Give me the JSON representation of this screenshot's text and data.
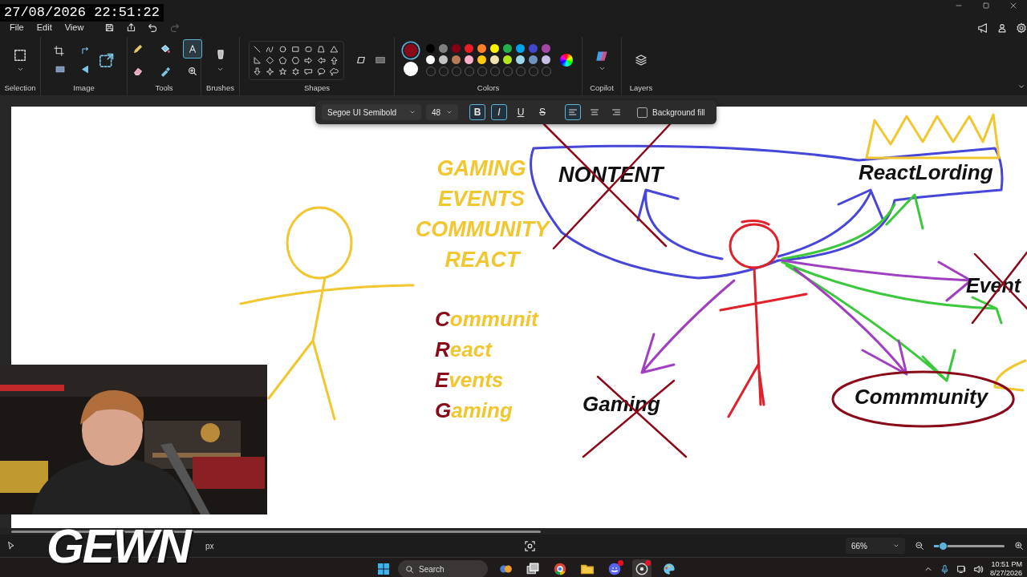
{
  "overlay": {
    "timestamp": "27/08/2026 22:51:22",
    "logo": "GEWN"
  },
  "menu": [
    "File",
    "Edit",
    "View"
  ],
  "quick_actions": {
    "undo": {
      "disabled": false
    },
    "redo": {
      "disabled": true
    }
  },
  "ribbon": {
    "groups": [
      "Selection",
      "Image",
      "Tools",
      "Brushes",
      "Shapes",
      "Colors",
      "Copilot",
      "Layers"
    ],
    "tools": [
      {
        "kind": "pencil",
        "selected": false
      },
      {
        "kind": "fill",
        "selected": false
      },
      {
        "kind": "text",
        "selected": true
      },
      {
        "kind": "eraser",
        "selected": false
      },
      {
        "kind": "picker",
        "selected": false
      },
      {
        "kind": "magnifier",
        "selected": false
      }
    ],
    "primary": {
      "color": "#8b0a1a"
    },
    "secondary": {
      "color": "#ffffff"
    },
    "palette": [
      {
        "color": "#000000"
      },
      {
        "color": "#7f7f7f"
      },
      {
        "color": "#880015"
      },
      {
        "color": "#ed1c24"
      },
      {
        "color": "#ff7f27"
      },
      {
        "color": "#fff200"
      },
      {
        "color": "#22b14c"
      },
      {
        "color": "#00a2e8"
      },
      {
        "color": "#3f48cc"
      },
      {
        "color": "#a349a4"
      },
      {
        "color": "#ffffff"
      },
      {
        "color": "#c3c3c3"
      },
      {
        "color": "#b97a57"
      },
      {
        "color": "#ffaec9"
      },
      {
        "color": "#ffc90e"
      },
      {
        "color": "#efe4b0"
      },
      {
        "color": "#b5e61d"
      },
      {
        "color": "#99d9ea"
      },
      {
        "color": "#7092be"
      },
      {
        "color": "#c8bfe7"
      }
    ]
  },
  "text_toolbar": {
    "font": "Segoe UI Semibold",
    "size": "48",
    "format": [
      {
        "kind": "bold",
        "label": "B",
        "selected": true
      },
      {
        "kind": "italic",
        "label": "I",
        "selected": true
      },
      {
        "kind": "underline",
        "label": "U",
        "selected": false
      },
      {
        "kind": "strikethrough",
        "label": "S",
        "selected": false
      }
    ],
    "align": [
      {
        "kind": "left",
        "selected": true
      },
      {
        "kind": "center",
        "selected": false
      },
      {
        "kind": "right",
        "selected": false
      }
    ],
    "background_fill": {
      "label": "Background fill",
      "checked": false
    }
  },
  "canvas": {
    "labels": [
      {
        "kind": "yellow",
        "text": "GAMING"
      },
      {
        "kind": "yellow",
        "text": "EVENTS"
      },
      {
        "kind": "yellow",
        "text": "COMMUNITY"
      },
      {
        "kind": "yellow",
        "text": "REACT"
      },
      {
        "kind": "initialed",
        "initial": "C",
        "text": "ommunit"
      },
      {
        "kind": "initialed",
        "initial": "R",
        "text": "eact"
      },
      {
        "kind": "initialed",
        "initial": "E",
        "text": "vents"
      },
      {
        "kind": "initialed",
        "initial": "G",
        "text": "aming"
      },
      {
        "kind": "black",
        "text": "NONTENT",
        "crossed_out": true,
        "circled": false
      },
      {
        "kind": "black",
        "text": "ReactLording",
        "crossed_out": false,
        "circled": false
      },
      {
        "kind": "black",
        "text": "Event",
        "crossed_out": true,
        "circled": false
      },
      {
        "kind": "black",
        "text": "Gaming",
        "crossed_out": true,
        "circled": false
      },
      {
        "kind": "black",
        "text": "Commmunity",
        "crossed_out": false,
        "circled": true
      }
    ]
  },
  "status_bar": {
    "position": "px",
    "zoom": "66%",
    "zoom_slider": {
      "level": 0.12
    }
  },
  "taskbar": {
    "search": {
      "placeholder": "Search"
    },
    "apps": [
      {
        "kind": "widgets",
        "badge": false,
        "active": false
      },
      {
        "kind": "task-view",
        "badge": false,
        "active": false
      },
      {
        "kind": "browser",
        "badge": false,
        "active": false
      },
      {
        "kind": "folder",
        "badge": false,
        "active": false
      },
      {
        "kind": "chat",
        "badge": true,
        "active": false
      },
      {
        "kind": "recorder",
        "badge": true,
        "active": true
      },
      {
        "kind": "paint",
        "badge": false,
        "active": false
      }
    ],
    "time": "10:51 PM",
    "date": "8/27/2026"
  }
}
